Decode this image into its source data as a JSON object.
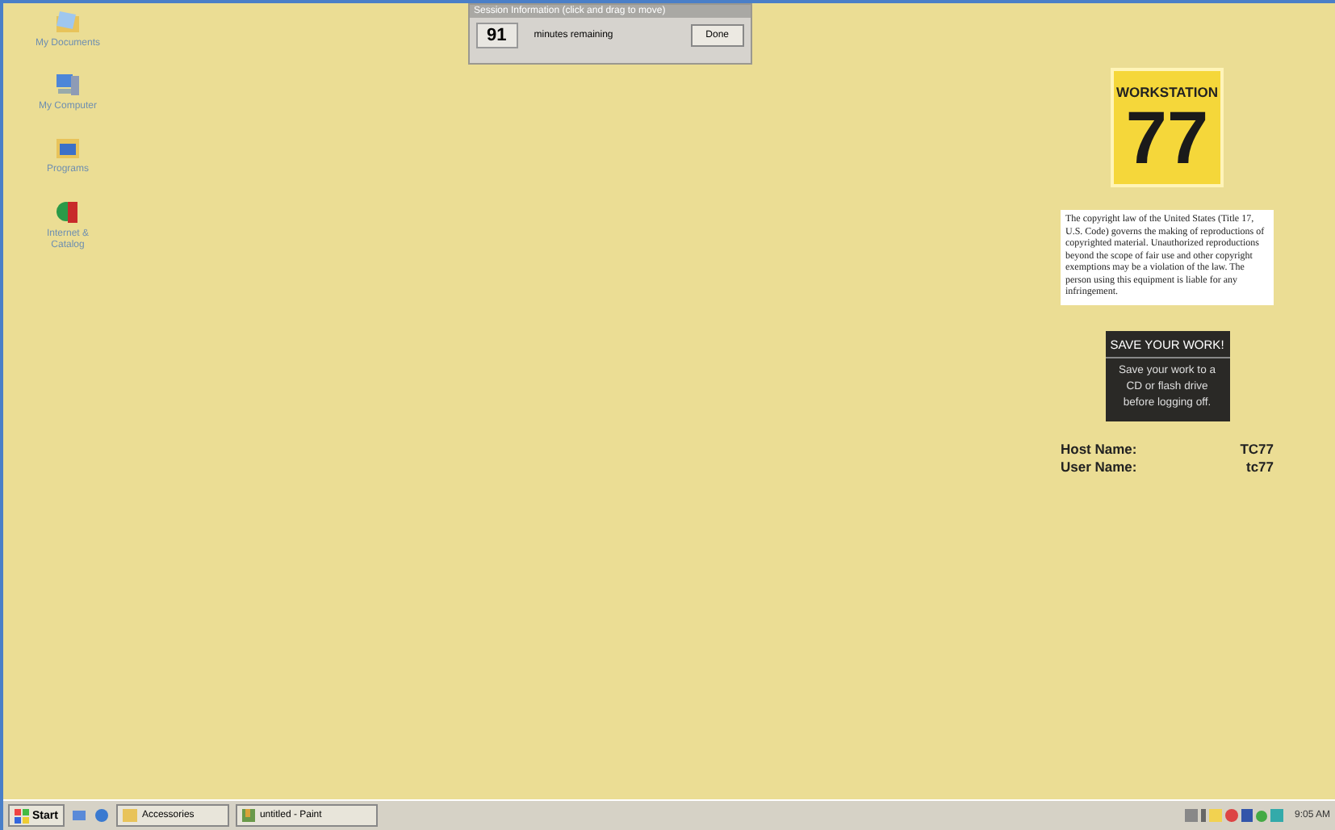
{
  "desktop_icons": [
    {
      "label": "My Documents",
      "kind": "documents"
    },
    {
      "label": "My Computer",
      "kind": "computer"
    },
    {
      "label": "Programs",
      "kind": "programs"
    },
    {
      "label": "Internet & Catalog",
      "kind": "internet"
    }
  ],
  "session": {
    "title": "Session Information (click and drag to move)",
    "minutes": "91",
    "caption": "minutes remaining",
    "button": "Done"
  },
  "workstation": {
    "label": "WORKSTATION",
    "number": "77"
  },
  "copyright": "The copyright law of the United States (Title 17, U.S. Code) governs the making of reproductions of copyrighted material. Unauthorized reproductions beyond the scope of fair use and other copyright exemptions may be a violation of the law. The person using this equipment is liable for any infringement.",
  "save_notice": {
    "title": "SAVE YOUR WORK!",
    "body": "Save your work to a CD or flash drive before logging off."
  },
  "info": [
    {
      "label": "Host Name:",
      "value": "TC77"
    },
    {
      "label": "User Name:",
      "value": "tc77"
    }
  ],
  "taskbar": {
    "start": "Start",
    "tasks": [
      {
        "label": "Accessories",
        "kind": "folder"
      },
      {
        "label": "untitled - Paint",
        "kind": "paint"
      }
    ],
    "clock": "9:05 AM"
  }
}
